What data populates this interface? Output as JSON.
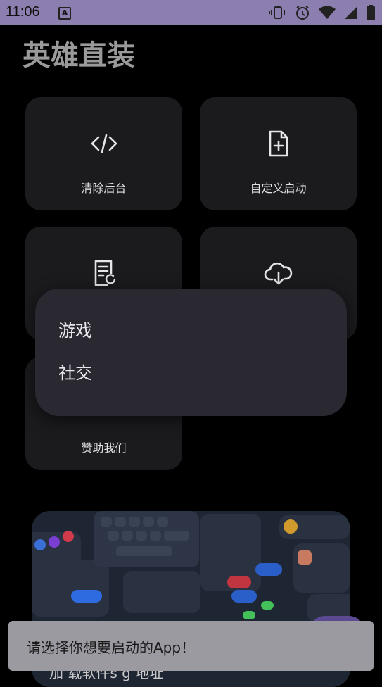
{
  "status_bar": {
    "time": "11:06",
    "notification_icon": "a-icon",
    "icons": [
      "vibrate-icon",
      "alarm-icon",
      "wifi-icon",
      "signal-icon",
      "battery-icon"
    ]
  },
  "page": {
    "title": "英雄直装"
  },
  "tiles": [
    {
      "label": "清除后台",
      "icon": "code-icon"
    },
    {
      "label": "自定义启动",
      "icon": "file-add-icon"
    },
    {
      "label": "",
      "icon": "document-sync-icon"
    },
    {
      "label": "",
      "icon": "cloud-download-icon"
    },
    {
      "label": "赞助我们",
      "icon": ""
    }
  ],
  "popup_menu": {
    "items": [
      "游戏",
      "社交"
    ]
  },
  "toast": {
    "message": "请选择你想要启动的App！"
  },
  "bottom_peek_text": "加  载软件s   g       地址"
}
